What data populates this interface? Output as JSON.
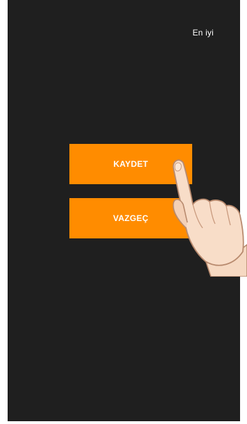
{
  "header": {
    "quality_label": "En iyi"
  },
  "dialog": {
    "save_label": "KAYDET",
    "cancel_label": "VAZGEÇ"
  },
  "colors": {
    "background": "#1f1f1f",
    "accent": "#ff8c00",
    "text": "#ffffff"
  },
  "overlay": {
    "icon": "pointing-hand-icon"
  }
}
